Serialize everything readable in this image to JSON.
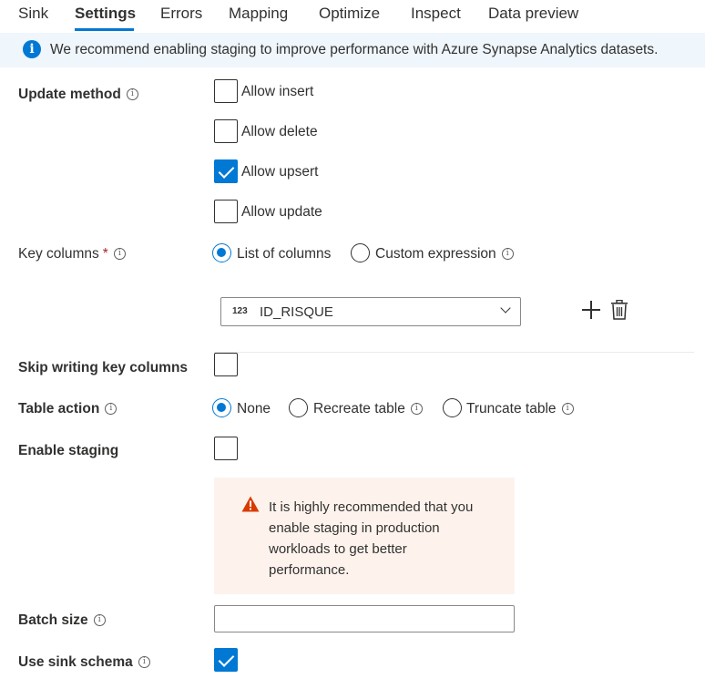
{
  "tabs": [
    {
      "label": "Sink"
    },
    {
      "label": "Settings"
    },
    {
      "label": "Errors"
    },
    {
      "label": "Mapping"
    },
    {
      "label": "Optimize"
    },
    {
      "label": "Inspect"
    },
    {
      "label": "Data preview"
    }
  ],
  "active_tab": "Settings",
  "banner": {
    "icon": "info-icon",
    "text": "We recommend enabling staging to improve performance with Azure Synapse Analytics datasets."
  },
  "update_method": {
    "label": "Update method",
    "options": [
      {
        "label": "Allow insert",
        "checked": false
      },
      {
        "label": "Allow delete",
        "checked": false
      },
      {
        "label": "Allow upsert",
        "checked": true
      },
      {
        "label": "Allow update",
        "checked": false
      }
    ]
  },
  "key_columns": {
    "label": "Key columns",
    "required_mark": "*",
    "options": [
      {
        "label": "List of columns",
        "selected": true
      },
      {
        "label": "Custom expression",
        "selected": false
      }
    ],
    "column": {
      "type_badge": "123",
      "value": "ID_RISQUE"
    }
  },
  "skip_writing_key_columns": {
    "label": "Skip writing key columns",
    "checked": false
  },
  "table_action": {
    "label": "Table action",
    "options": [
      {
        "label": "None",
        "selected": true
      },
      {
        "label": "Recreate table",
        "selected": false
      },
      {
        "label": "Truncate table",
        "selected": false
      }
    ]
  },
  "enable_staging": {
    "label": "Enable staging",
    "checked": false
  },
  "warning": {
    "icon": "warning-icon",
    "text": "It is highly recommended that you enable staging in production workloads to get better performance."
  },
  "batch_size": {
    "label": "Batch size",
    "value": ""
  },
  "use_sink_schema": {
    "label": "Use sink schema",
    "checked": true
  },
  "info_glyph": "i",
  "colors": {
    "accent": "#0078d4",
    "banner_bg": "#eff6fc",
    "warning_bg": "#fdf3ec",
    "warning_icon": "#d83b01",
    "required": "#a4262c"
  }
}
